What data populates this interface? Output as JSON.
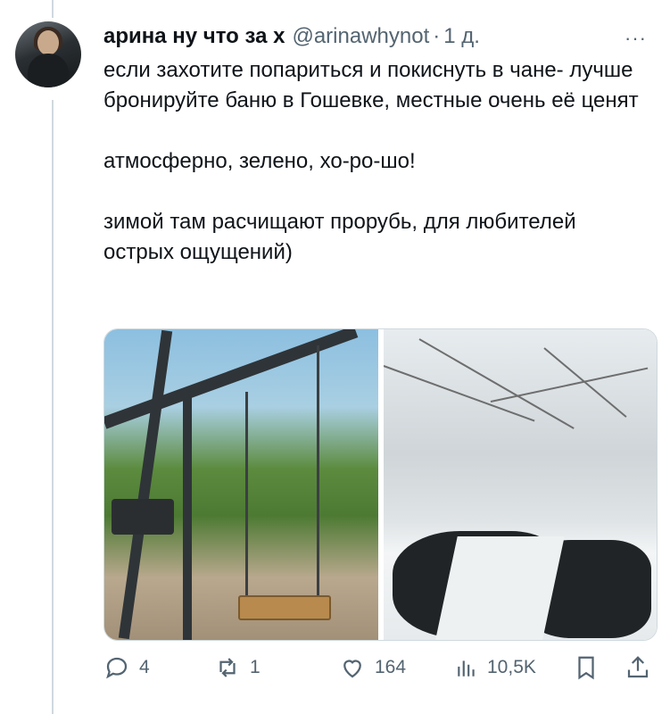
{
  "tweet": {
    "author_name": "арина ну что за х",
    "handle": "@arinawhynot",
    "separator": "·",
    "time": "1 д.",
    "more_label": "···",
    "paragraphs": [
      "если захотите попариться и покиснуть в чане- лучше бронируйте баню в Гошевке, местные очень её ценят",
      "атмосферно, зелено, хо-ро-шо!",
      "зимой там расчищают прорубь, для любителей острых ощущений)"
    ],
    "media": [
      {
        "icon": "summer-swing-photo"
      },
      {
        "icon": "winter-pool-photo"
      }
    ],
    "actions": {
      "replies": "4",
      "retweets": "1",
      "likes": "164",
      "views": "10,5K"
    }
  },
  "colors": {
    "text": "#0f1419",
    "secondary": "#536471",
    "thread_line": "#cfd9de"
  }
}
